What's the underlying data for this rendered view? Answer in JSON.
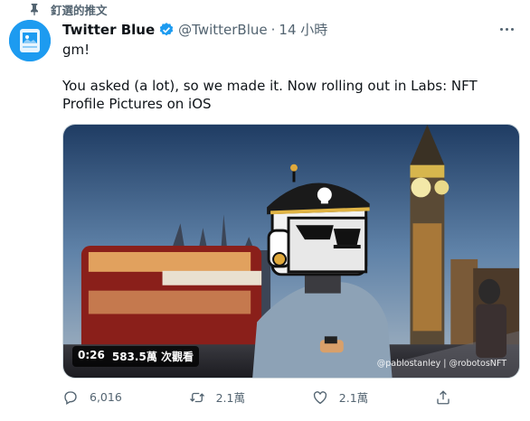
{
  "pinned_label": "釘選的推文",
  "tweet": {
    "display_name": "Twitter Blue",
    "handle": "@TwitterBlue",
    "separator": "·",
    "timestamp": "14 小時",
    "line1": "gm!",
    "line2": "You asked (a lot), so we made it. Now rolling out in Labs: NFT Profile Pictures on iOS"
  },
  "video": {
    "duration": "0:26",
    "views": "583.5萬 次觀看",
    "credit": "@pablostanley | @robotosNFT"
  },
  "actions": {
    "reply_count": "6,016",
    "retweet_count": "2.1萬",
    "like_count": "2.1萬"
  },
  "colors": {
    "accent": "#1d9bf0",
    "secondary_text": "#536471"
  },
  "icons": [
    "pin-icon",
    "verified-badge-icon",
    "more-icon",
    "reply-icon",
    "retweet-icon",
    "like-icon",
    "share-icon"
  ]
}
